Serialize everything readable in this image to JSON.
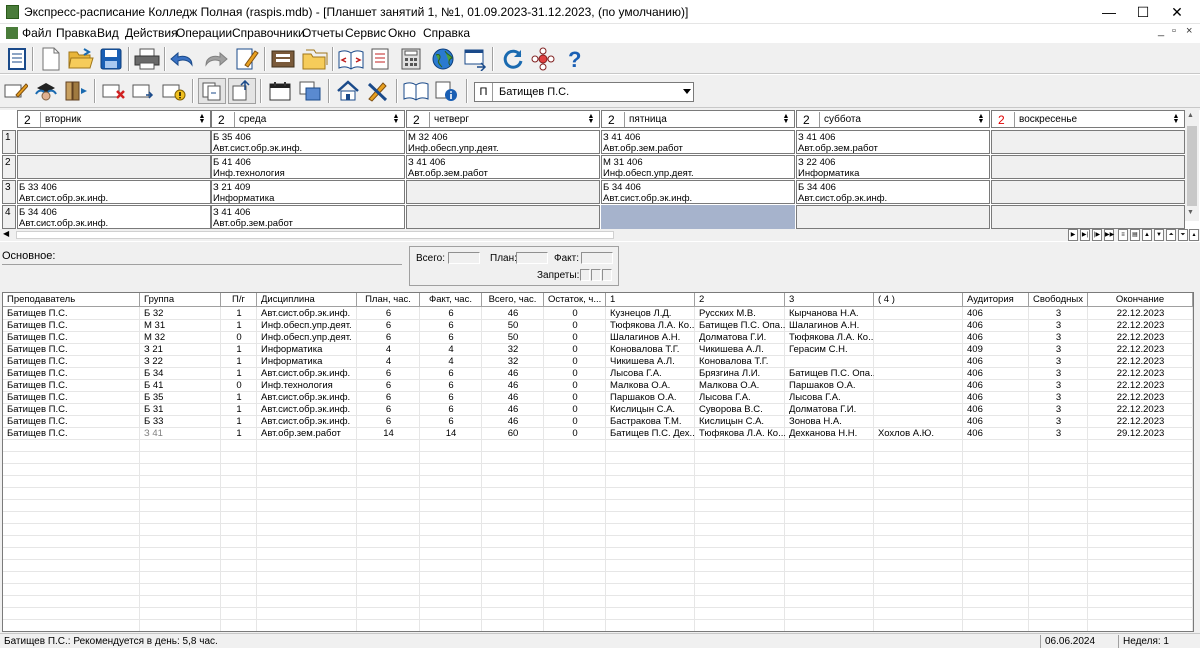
{
  "window": {
    "title": "Экспресс-расписание Колледж Полная (raspis.mdb) - [Планшет занятий 1, №1, 01.09.2023-31.12.2023, (по умолчанию)]",
    "minimize": "—",
    "maximize": "☐",
    "close": "✕"
  },
  "menu": [
    "Файл",
    "Правка",
    "Вид",
    "Действия",
    "Операции",
    "Справочники",
    "Отчеты",
    "Сервис",
    "Окно",
    "Справка"
  ],
  "mdi_controls": {
    "min": "_",
    "restore": "▫",
    "close": "×"
  },
  "teacher_selector": {
    "prefix": "П",
    "value": "Батищев П.С."
  },
  "days": [
    {
      "count": "2",
      "name": "вторник",
      "red": false
    },
    {
      "count": "2",
      "name": "среда",
      "red": false
    },
    {
      "count": "2",
      "name": "четверг",
      "red": false
    },
    {
      "count": "2",
      "name": "пятница",
      "red": false
    },
    {
      "count": "2",
      "name": "суббота",
      "red": false
    },
    {
      "count": "2",
      "name": "воскресенье",
      "red": true
    }
  ],
  "schedule_rows": [
    {
      "num": "1",
      "cells": [
        null,
        {
          "line1": "Б 35   406",
          "line2": "Авт.сист.обр.эк.инф."
        },
        {
          "line1": "М 32   406",
          "line2": "Инф.обесп.упр.деят."
        },
        {
          "line1": "З 41   406",
          "line2": "Авт.обр.зем.работ"
        },
        {
          "line1": "З 41   406",
          "line2": "Авт.обр.зем.работ"
        },
        null
      ]
    },
    {
      "num": "2",
      "cells": [
        null,
        {
          "line1": "Б 41   406",
          "line2": "Инф.технология"
        },
        {
          "line1": "З 41   406",
          "line2": "Авт.обр.зем.работ"
        },
        {
          "line1": "М 31   406",
          "line2": "Инф.обесп.упр.деят."
        },
        {
          "line1": "З 22   406",
          "line2": "Информатика"
        },
        null
      ]
    },
    {
      "num": "3",
      "cells": [
        {
          "line1": "Б 33   406",
          "line2": "Авт.сист.обр.эк.инф."
        },
        {
          "line1": "З 21   409",
          "line2": "Информатика"
        },
        null,
        {
          "line1": "Б 34   406",
          "line2": "Авт.сист.обр.эк.инф."
        },
        {
          "line1": "Б 34   406",
          "line2": "Авт.сист.обр.эк.инф."
        },
        null
      ]
    },
    {
      "num": "4",
      "cells": [
        {
          "line1": "Б 34   406",
          "line2": "Авт.сист.обр.эк.инф."
        },
        {
          "line1": "З 41   406",
          "line2": "Авт.обр.зем.работ"
        },
        null,
        "selected",
        null,
        null
      ]
    }
  ],
  "main_section": {
    "label": "Основное:",
    "total_label": "Всего:",
    "plan_label": "План:",
    "fact_label": "Факт:",
    "bans_label": "Запреты:"
  },
  "table": {
    "columns": [
      "Преподаватель",
      "Группа",
      "П/г",
      "Дисциплина",
      "План, час.",
      "Факт, час.",
      "Всего, час.",
      "Остаток, ч...",
      "1",
      "2",
      "3",
      "( 4 )",
      "Аудитория",
      "Свободных",
      "Окончание"
    ],
    "rows": [
      [
        "Батищев П.С.",
        "Б 32",
        "1",
        "Авт.сист.обр.эк.инф.",
        "6",
        "6",
        "46",
        "0",
        "Кузнецов Л.Д.",
        "Русских М.В.",
        "Кырчанова Н.А.",
        "",
        "406",
        "3",
        "22.12.2023"
      ],
      [
        "Батищев П.С.",
        "М 31",
        "1",
        "Инф.обесп.упр.деят.",
        "6",
        "6",
        "50",
        "0",
        "Тюфякова Л.А. Ко...",
        "Батищев П.С. Опа...",
        "Шалагинов А.Н.",
        "",
        "406",
        "3",
        "22.12.2023"
      ],
      [
        "Батищев П.С.",
        "М 32",
        "0",
        "Инф.обесп.упр.деят.",
        "6",
        "6",
        "50",
        "0",
        "Шалагинов А.Н.",
        "Долматова Г.И.",
        "Тюфякова Л.А. Ко...",
        "",
        "406",
        "3",
        "22.12.2023"
      ],
      [
        "Батищев П.С.",
        "З 21",
        "1",
        "Информатика",
        "4",
        "4",
        "32",
        "0",
        "Коновалова Т.Г.",
        "Чикишева А.Л.",
        "Герасим С.Н.",
        "",
        "409",
        "3",
        "22.12.2023"
      ],
      [
        "Батищев П.С.",
        "З 22",
        "1",
        "Информатика",
        "4",
        "4",
        "32",
        "0",
        "Чикишева А.Л.",
        "Коновалова Т.Г.",
        "",
        "",
        "406",
        "3",
        "22.12.2023"
      ],
      [
        "Батищев П.С.",
        "Б 34",
        "1",
        "Авт.сист.обр.эк.инф.",
        "6",
        "6",
        "46",
        "0",
        "Лысова Г.А.",
        "Брязгина Л.И.",
        "Батищев П.С. Опа...",
        "",
        "406",
        "3",
        "22.12.2023"
      ],
      [
        "Батищев П.С.",
        "Б 41",
        "0",
        "Инф.технология",
        "6",
        "6",
        "46",
        "0",
        "Малкова О.А.",
        "Малкова О.А.",
        "Паршаков О.А.",
        "",
        "406",
        "3",
        "22.12.2023"
      ],
      [
        "Батищев П.С.",
        "Б 35",
        "1",
        "Авт.сист.обр.эк.инф.",
        "6",
        "6",
        "46",
        "0",
        "Паршаков О.А.",
        "Лысова Г.А.",
        "Лысова Г.А.",
        "",
        "406",
        "3",
        "22.12.2023"
      ],
      [
        "Батищев П.С.",
        "Б 31",
        "1",
        "Авт.сист.обр.эк.инф.",
        "6",
        "6",
        "46",
        "0",
        "Кислицын С.А.",
        "Суворова В.С.",
        "Долматова Г.И.",
        "",
        "406",
        "3",
        "22.12.2023"
      ],
      [
        "Батищев П.С.",
        "Б 33",
        "1",
        "Авт.сист.обр.эк.инф.",
        "6",
        "6",
        "46",
        "0",
        "Бастракова Т.М.",
        "Кислицын С.А.",
        "Зонова Н.А.",
        "",
        "406",
        "3",
        "22.12.2023"
      ],
      [
        "Батищев П.С.",
        "З 41",
        "1",
        "Авт.обр.зем.работ",
        "14",
        "14",
        "60",
        "0",
        "Батищев П.С. Дех...",
        "Тюфякова Л.А. Ко...",
        "Дехканова Н.Н.",
        "Хохлов А.Ю.",
        "406",
        "3",
        "29.12.2023"
      ]
    ],
    "grey_group_row": 10
  },
  "status": {
    "message": "Батищев П.С.: Рекомендуется в день: 5,8 час.",
    "date": "06.06.2024",
    "week": "Неделя: 1"
  }
}
